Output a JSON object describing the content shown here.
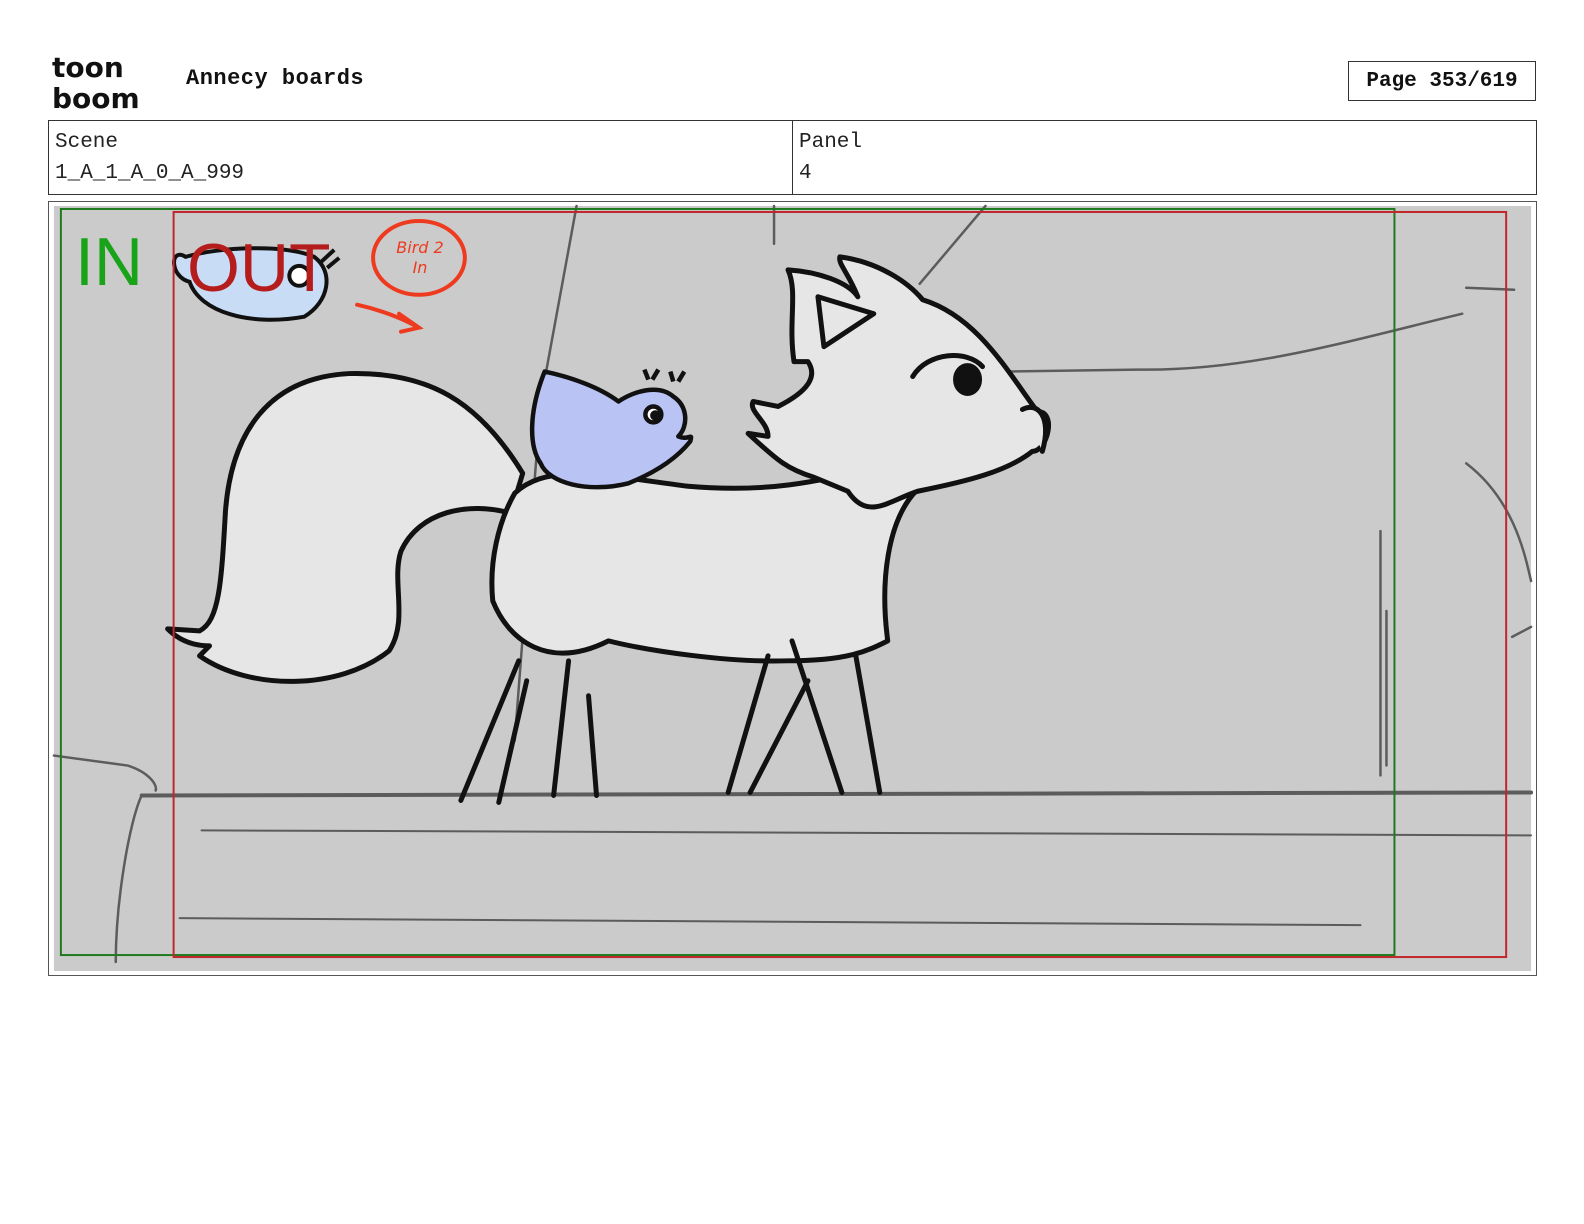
{
  "header": {
    "logo_text_top": "toon",
    "logo_text_bottom": "boom",
    "title": "Annecy boards",
    "page": "Page 353/619"
  },
  "info": {
    "scene_label": "Scene",
    "scene_value": "1_A_1_A_0_A_999",
    "panel_label": "Panel",
    "panel_value": "4"
  },
  "panel_art": {
    "in_label": "IN",
    "out_label": "OUT",
    "note_line1": "Bird 2",
    "note_line2": "In",
    "colors": {
      "background": "#cbcbcb",
      "in_frame": "#1f7a1f",
      "out_frame": "#c0262b",
      "fox_fill": "#e6e6e6",
      "bird_fill": "#b9c4f5",
      "bird_ghost_fill": "#c8ddf5",
      "note_ink": "#ee3a1f"
    }
  }
}
